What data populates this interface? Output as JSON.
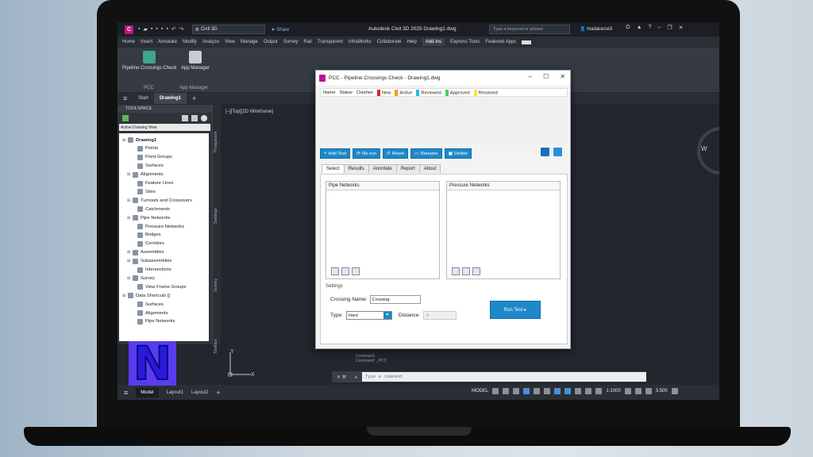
{
  "titlebar": {
    "app_logo": "C",
    "workspace": "Civil 3D",
    "share": "Share",
    "title": "Autodesk Civil 3D 2025   Drawing1.dwg",
    "search_placeholder": "Type a keyword or phrase",
    "user": "madararce3"
  },
  "ribbon": {
    "tabs": [
      "Home",
      "Insert",
      "Annotate",
      "Modify",
      "Analyze",
      "View",
      "Manage",
      "Output",
      "Survey",
      "Rail",
      "Transparent",
      "InfraWorks",
      "Collaborate",
      "Help",
      "Add-ins",
      "Express Tools",
      "Featured Apps"
    ],
    "active_tab": "Add-ins",
    "buttons": {
      "pcc_button": "Pipeline Crossings Check",
      "app_manager": "App Manager",
      "pcc_panel": "PCC",
      "app_manager_panel": "App Manager"
    }
  },
  "file_tabs": {
    "start": "Start",
    "drawing": "Drawing1",
    "add": "+"
  },
  "toolspace": {
    "header": "TOOLSPACE",
    "view": "Active Drawing View",
    "tree": [
      {
        "label": "Drawing1",
        "level": 0,
        "bold": true
      },
      {
        "label": "Points",
        "level": 2
      },
      {
        "label": "Point Groups",
        "level": 2
      },
      {
        "label": "Surfaces",
        "level": 2
      },
      {
        "label": "Alignments",
        "level": 1
      },
      {
        "label": "Feature Lines",
        "level": 2
      },
      {
        "label": "Sites",
        "level": 2
      },
      {
        "label": "Turnouts and Crossovers",
        "level": 1
      },
      {
        "label": "Catchments",
        "level": 2
      },
      {
        "label": "Pipe Networks",
        "level": 1
      },
      {
        "label": "Pressure Networks",
        "level": 2
      },
      {
        "label": "Bridges",
        "level": 2
      },
      {
        "label": "Corridors",
        "level": 2
      },
      {
        "label": "Assemblies",
        "level": 1
      },
      {
        "label": "Subassemblies",
        "level": 1
      },
      {
        "label": "Intersections",
        "level": 2
      },
      {
        "label": "Survey",
        "level": 1
      },
      {
        "label": "View Frame Groups",
        "level": 2
      },
      {
        "label": "Data Shortcuts []",
        "level": 0
      },
      {
        "label": "Surfaces",
        "level": 2
      },
      {
        "label": "Alignments",
        "level": 2
      },
      {
        "label": "Pipe Networks",
        "level": 2
      }
    ],
    "side_tabs": [
      "Prospector",
      "Settings",
      "Survey",
      "Toolbox"
    ]
  },
  "viewport": {
    "label": "[–][Top][2D Wireframe]",
    "compass_w": "W",
    "ucs_x": "X",
    "ucs_y": "Y",
    "history": [
      "Command:",
      "Command: _PCC"
    ]
  },
  "command": {
    "placeholder": "Type a command"
  },
  "statusbar": {
    "tabs": [
      "Model",
      "Layout1",
      "Layout2"
    ],
    "add": "+",
    "model": "MODEL",
    "scale": "1:1000",
    "value": "3.500"
  },
  "dialog": {
    "title": "PCC - Pipeline Crossings Check - Drawing1.dwg",
    "legend": {
      "cols": [
        "Name",
        "Status",
        "Clashes"
      ],
      "statuses": [
        {
          "label": "New",
          "color": "#d9262b"
        },
        {
          "label": "Active",
          "color": "#f29b1e"
        },
        {
          "label": "Reviewed",
          "color": "#2eb8e6"
        },
        {
          "label": "Approved",
          "color": "#3fd24a"
        },
        {
          "label": "Resolved",
          "color": "#f5ea3b"
        }
      ]
    },
    "toolbar": {
      "add_test": "Add Test",
      "rerun": "Re-run",
      "reset": "Reset",
      "rename": "Rename",
      "delete": "Delete"
    },
    "tabs": [
      "Select",
      "Results",
      "Annotate",
      "Report",
      "About"
    ],
    "active_tab": "Select",
    "pipe_networks": "Pipe Networks",
    "pressure_networks": "Pressure Networks",
    "settings": {
      "label": "Settings",
      "crossing_name_label": "Crossing Name:",
      "crossing_name_value": "Crossing-",
      "type_label": "Type:",
      "type_value": "Hard",
      "distance_label": "Distance:",
      "distance_value": "0"
    },
    "run_test": "Run Test"
  }
}
